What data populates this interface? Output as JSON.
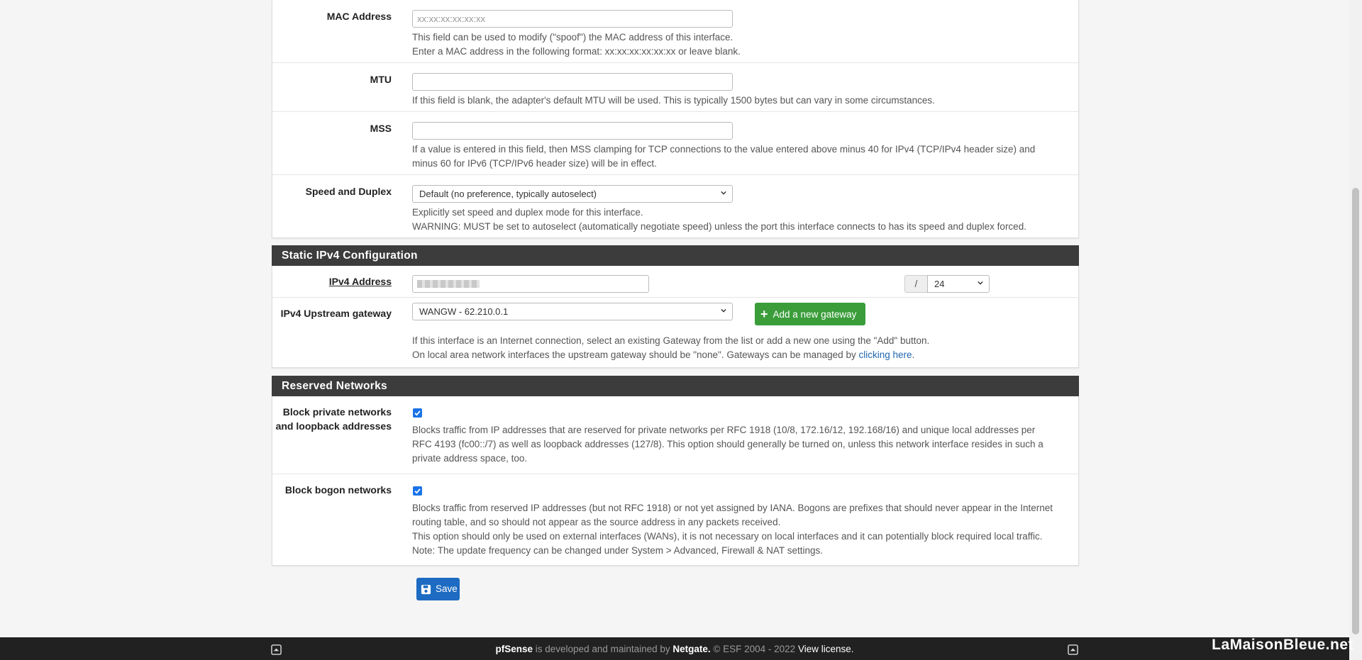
{
  "interface": {
    "mac": {
      "label": "MAC Address",
      "placeholder": "xx:xx:xx:xx:xx:xx",
      "help1": "This field can be used to modify (\"spoof\") the MAC address of this interface.",
      "help2": "Enter a MAC address in the following format: xx:xx:xx:xx:xx:xx or leave blank."
    },
    "mtu": {
      "label": "MTU",
      "value": "",
      "help": "If this field is blank, the adapter's default MTU will be used. This is typically 1500 bytes but can vary in some circumstances."
    },
    "mss": {
      "label": "MSS",
      "value": "",
      "help1": "If a value is entered in this field, then MSS clamping for TCP connections to the value entered above minus 40 for IPv4 (TCP/IPv4 header size) and",
      "help2": "minus 60 for IPv6 (TCP/IPv6 header size) will be in effect."
    },
    "speed": {
      "label": "Speed and Duplex",
      "selected": "Default (no preference, typically autoselect)",
      "help1": "Explicitly set speed and duplex mode for this interface.",
      "help2": "WARNING: MUST be set to autoselect (automatically negotiate speed) unless the port this interface connects to has its speed and duplex forced."
    }
  },
  "static_ipv4": {
    "heading": "Static IPv4 Configuration",
    "address_label": "IPv4 Address",
    "slash": "/",
    "prefix": "24",
    "gateway_label": "IPv4 Upstream gateway",
    "gateway_selected": "WANGW - 62.210.0.1",
    "add_gateway_label": "Add a new gateway",
    "help1": "If this interface is an Internet connection, select an existing Gateway from the list or add a new one using the \"Add\" button.",
    "help2_pre": "On local area network interfaces the upstream gateway should be \"none\". Gateways can be managed by ",
    "help2_link": "clicking here",
    "help2_post": "."
  },
  "reserved": {
    "heading": "Reserved Networks",
    "private_label_1": "Block private networks",
    "private_label_2": "and loopback addresses",
    "private_checked": true,
    "private_help1": "Blocks traffic from IP addresses that are reserved for private networks per RFC 1918 (10/8, 172.16/12, 192.168/16) and unique local addresses per",
    "private_help2": "RFC 4193 (fc00::/7) as well as loopback addresses (127/8). This option should generally be turned on, unless this network interface resides in such a",
    "private_help3": "private address space, too.",
    "bogon_label": "Block bogon networks",
    "bogon_checked": true,
    "bogon_help1": "Blocks traffic from reserved IP addresses (but not RFC 1918) or not yet assigned by IANA. Bogons are prefixes that should never appear in the Internet",
    "bogon_help2": "routing table, and so should not appear as the source address in any packets received.",
    "bogon_help3": "This option should only be used on external interfaces (WANs), it is not necessary on local interfaces and it can potentially block required local traffic.",
    "bogon_help4": "Note: The update frequency can be changed under System > Advanced, Firewall & NAT settings."
  },
  "save_label": "Save",
  "footer": {
    "brand": "pfSense",
    "dev_text": " is developed and maintained by ",
    "company": "Netgate.",
    "copyright": " © ESF 2004 - 2022 ",
    "license": "View license."
  },
  "watermark": "LaMaisonBleue.net",
  "colors": {
    "accent_blue": "#1d6bc2",
    "green": "#3a9d3a",
    "header": "#3c3c3c",
    "footer": "#212121"
  }
}
